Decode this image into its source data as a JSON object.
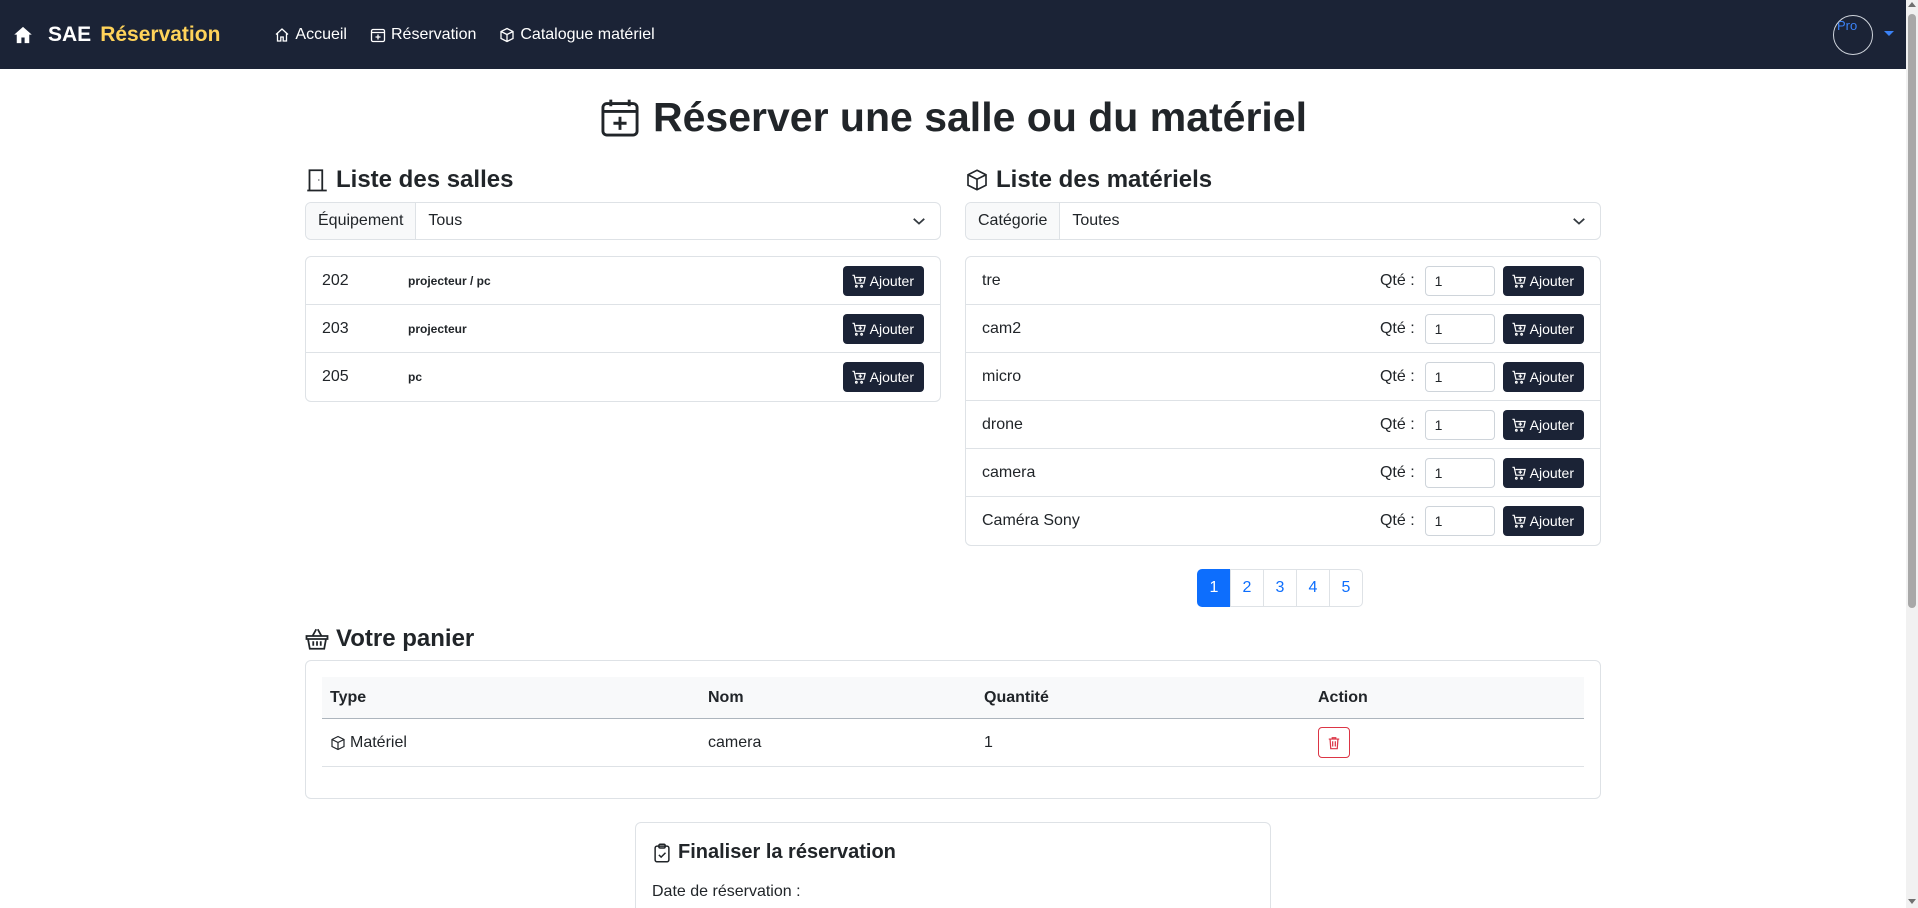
{
  "brand": {
    "part1": "SAE",
    "part2": "Réservation"
  },
  "nav": {
    "home": "Accueil",
    "reservation": "Réservation",
    "catalogue": "Catalogue matériel"
  },
  "user": {
    "avatar_alt": "Pro"
  },
  "page_title": "Réserver une salle ou du matériel",
  "salles": {
    "heading": "Liste des salles",
    "filter_label": "Équipement",
    "filter_value": "Tous",
    "add_label": "Ajouter",
    "rows": [
      {
        "num": "202",
        "equipement": "projecteur / pc"
      },
      {
        "num": "203",
        "equipement": "projecteur"
      },
      {
        "num": "205",
        "equipement": "pc"
      }
    ]
  },
  "materiels": {
    "heading": "Liste des matériels",
    "filter_label": "Catégorie",
    "filter_value": "Toutes",
    "qty_label": "Qté :",
    "add_label": "Ajouter",
    "rows": [
      {
        "name": "tre",
        "qty": "1"
      },
      {
        "name": "cam2",
        "qty": "1"
      },
      {
        "name": "micro",
        "qty": "1"
      },
      {
        "name": "drone",
        "qty": "1"
      },
      {
        "name": "camera",
        "qty": "1"
      },
      {
        "name": "Caméra Sony",
        "qty": "1"
      }
    ]
  },
  "pagination": {
    "pages": [
      "1",
      "2",
      "3",
      "4",
      "5"
    ],
    "current": "1"
  },
  "panier": {
    "heading": "Votre panier",
    "columns": {
      "type": "Type",
      "nom": "Nom",
      "quantite": "Quantité",
      "action": "Action"
    },
    "rows": [
      {
        "type": "Matériel",
        "nom": "camera",
        "quantite": "1"
      }
    ]
  },
  "finaliser": {
    "heading": "Finaliser la réservation",
    "date_label": "Date de réservation :"
  },
  "colors": {
    "navbar": "#1b2336",
    "brand_accent": "#ffd35a",
    "primary": "#0d6efd",
    "danger": "#dc3545"
  }
}
